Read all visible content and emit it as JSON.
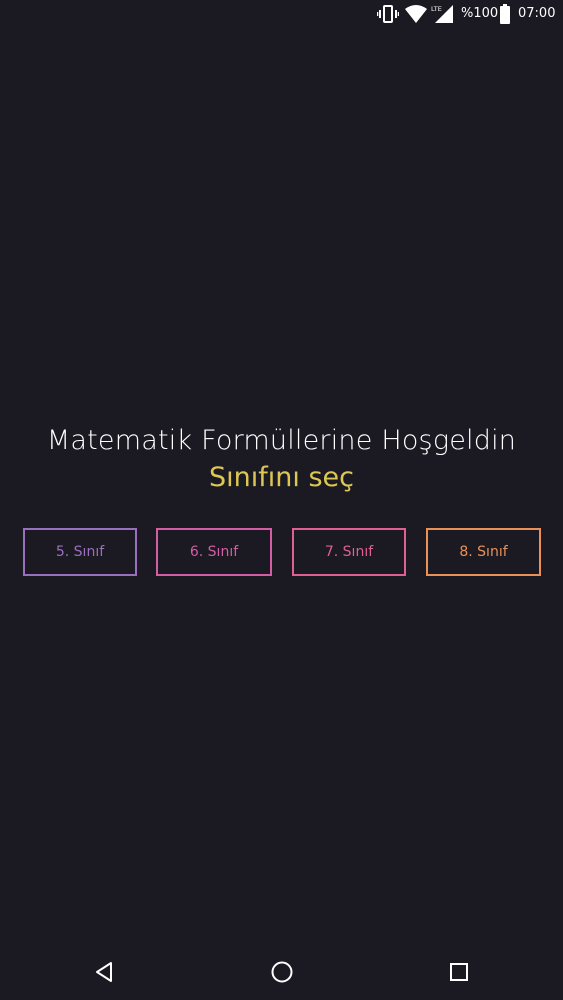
{
  "status_bar": {
    "battery_percent": "%100",
    "time": "07:00",
    "network_type": "LTE",
    "icons": [
      "vibrate-icon",
      "wifi-icon",
      "lte-signal-icon",
      "battery-icon"
    ]
  },
  "main": {
    "title": "Matematik Formüllerine Hoşgeldin",
    "subtitle": "Sınıfını seç",
    "grades": [
      {
        "label": "5. Sınıf",
        "color": "#9b6fc0"
      },
      {
        "label": "6. Sınıf",
        "color": "#d45ea3"
      },
      {
        "label": "7. Sınıf",
        "color": "#df5f97"
      },
      {
        "label": "8. Sınıf",
        "color": "#ea9158"
      }
    ]
  },
  "colors": {
    "background": "#1b1a22",
    "subtitle": "#dcc755"
  },
  "nav_bar": {
    "icons": [
      "back-icon",
      "home-icon",
      "recents-icon"
    ]
  }
}
